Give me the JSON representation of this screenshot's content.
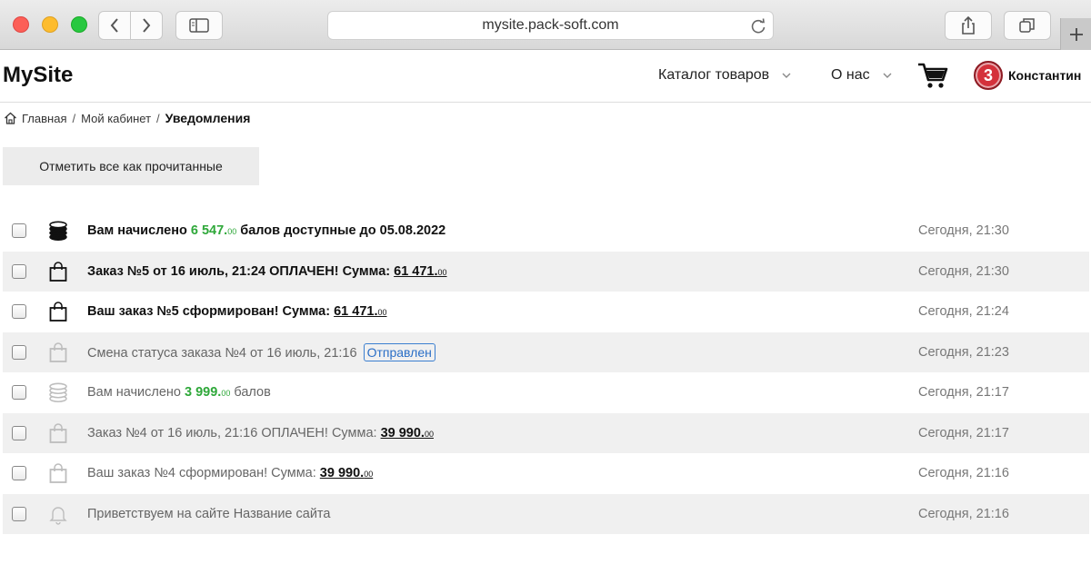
{
  "browser": {
    "url": "mysite.pack-soft.com"
  },
  "header": {
    "logo": "MySite",
    "menu": [
      {
        "label": "Каталог товаров"
      },
      {
        "label": "О нас"
      }
    ],
    "user": {
      "badge": "3",
      "name": "Константин"
    }
  },
  "breadcrumb": {
    "home": "Главная",
    "cabinet": "Мой кабинет",
    "current": "Уведомления"
  },
  "actions": {
    "mark_all_read": "Отметить все как прочитанные"
  },
  "notifications": [
    {
      "icon": "coins-icon",
      "unread": true,
      "pre": "Вам начислено ",
      "green_main": "6 547.",
      "green_small": "00",
      "post": " балов доступные до 05.08.2022",
      "time": "Сегодня, 21:30"
    },
    {
      "icon": "bag-icon",
      "unread": true,
      "pre": "Заказ №5 от 16 июль, 21:24 ОПЛАЧЕН! Сумма: ",
      "link_main": "61 471.",
      "link_small": "00",
      "time": "Сегодня, 21:30"
    },
    {
      "icon": "bag-icon",
      "unread": true,
      "pre": "Ваш заказ №5 сформирован! Сумма: ",
      "link_main": "61 471.",
      "link_small": "00",
      "time": "Сегодня, 21:24"
    },
    {
      "icon": "bag-icon",
      "unread": false,
      "pre": "Смена статуса заказа №4 от 16 июль, 21:16 ",
      "badge": "Отправлен",
      "time": "Сегодня, 21:23"
    },
    {
      "icon": "coins-icon",
      "unread": false,
      "pre": "Вам начислено ",
      "green_main": "3 999.",
      "green_small": "00",
      "post": " балов",
      "time": "Сегодня, 21:17"
    },
    {
      "icon": "bag-icon",
      "unread": false,
      "pre": "Заказ №4 от 16 июль, 21:16 ОПЛАЧЕН! Сумма: ",
      "link_main": "39 990.",
      "link_small": "00",
      "time": "Сегодня, 21:17"
    },
    {
      "icon": "bag-icon",
      "unread": false,
      "pre": "Ваш заказ №4 сформирован! Сумма: ",
      "link_main": "39 990.",
      "link_small": "00",
      "time": "Сегодня, 21:16"
    },
    {
      "icon": "bell-icon",
      "unread": false,
      "pre": "Приветствуем на сайте Название сайта",
      "time": "Сегодня, 21:16"
    }
  ]
}
